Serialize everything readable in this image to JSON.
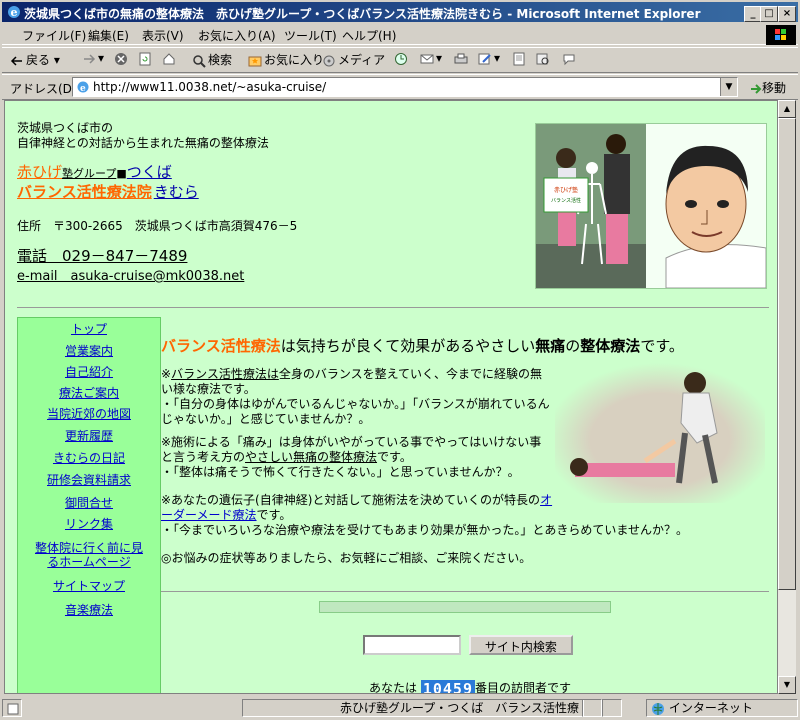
{
  "window": {
    "title": "茨城県つくば市の無痛の整体療法　赤ひげ塾グループ・つくばバランス活性療法院きむら - Microsoft Internet Explorer",
    "controls": {
      "minimize": "_",
      "maximize": "□",
      "close": "×"
    }
  },
  "menu": [
    "ファイル(F)",
    "編集(E)",
    "表示(V)",
    "お気に入り(A)",
    "ツール(T)",
    "ヘルプ(H)"
  ],
  "toolbar": {
    "back": "戻る",
    "search": "検索",
    "favorites": "お気に入り",
    "media": "メディア"
  },
  "address": {
    "label": "アドレス(D)",
    "url": "http://www11.0038.net/~asuka-cruise/",
    "go": "移動"
  },
  "page": {
    "header_line1": "茨城県つくば市の",
    "header_line2": "自律神経との対話から生まれた無痛の整体療法",
    "brand_red": "赤ひげ",
    "brand_small": "塾グループ",
    "brand_city": "つくば",
    "brand_clinic": "バランス活性療法院",
    "brand_name": "きむら",
    "address": "住所　〒300-2665　茨城県つくば市高須賀476－5",
    "tel": "電話　029－847－7489",
    "email": "e-mail　asuka-cruise@mk0038.net",
    "nav": [
      "トップ",
      "営業案内",
      "自己紹介",
      "療法ご案内",
      "当院近郊の地図",
      "更新履歴",
      "きむらの日記",
      "研修会資料請求",
      "御問合せ",
      "リンク集",
      "整体院に行く前に見るホームページ",
      "サイトマップ",
      "音楽療法"
    ],
    "lead_orange": "バランス活性療法",
    "lead_mid": "は気持ちが良くて効果があるやさしい",
    "lead_bold1": "無痛",
    "lead_no": "の",
    "lead_bold2": "整体療法",
    "lead_end": "です。",
    "para1_link": "バランス活性療法は",
    "para1_text": "全身のバランスを整えていく、今までに経験の無い様な療法です。",
    "para1_q": "・「自分の身体はゆがんでいるんじゃないか。」「バランスが崩れているんじゃないか。」と感じていませんか？。",
    "para2_a": "※施術による「痛み」は身体がいやがっている事でやってはいけない事と言う考え方の",
    "para2_link": "やさしい無痛の整体療法",
    "para2_b": "です。",
    "para2_q": "・「整体は痛そうで怖くて行きたくない。」と思っていませんか？。",
    "para3_a": "※あなたの遺伝子(自律神経)と対話して施術法を決めていくのが特長の",
    "para3_link": "オーダーメード療法",
    "para3_b": "です。",
    "para3_q": "・「今までいろいろな治療や療法を受けてもあまり効果が無かった。」とあきらめていませんか？。",
    "para4": "◎お悩みの症状等ありましたら、お気軽にご相談、ご来院ください。",
    "search_button": "サイト内検索",
    "visitor_prefix": "あなたは",
    "visitor_count": "10459",
    "visitor_suffix": "番目の訪問者です",
    "photo_sign": "赤ひげ塾グループ バランス活性療法"
  },
  "status": {
    "text": "赤ひげ塾グループ・つくば　バランス活性療",
    "zone": "インターネット"
  },
  "colors": {
    "bg": "#ccffcc",
    "nav_bg": "#99ff99",
    "accent_orange": "#ff6600",
    "link": "#0000cc"
  }
}
